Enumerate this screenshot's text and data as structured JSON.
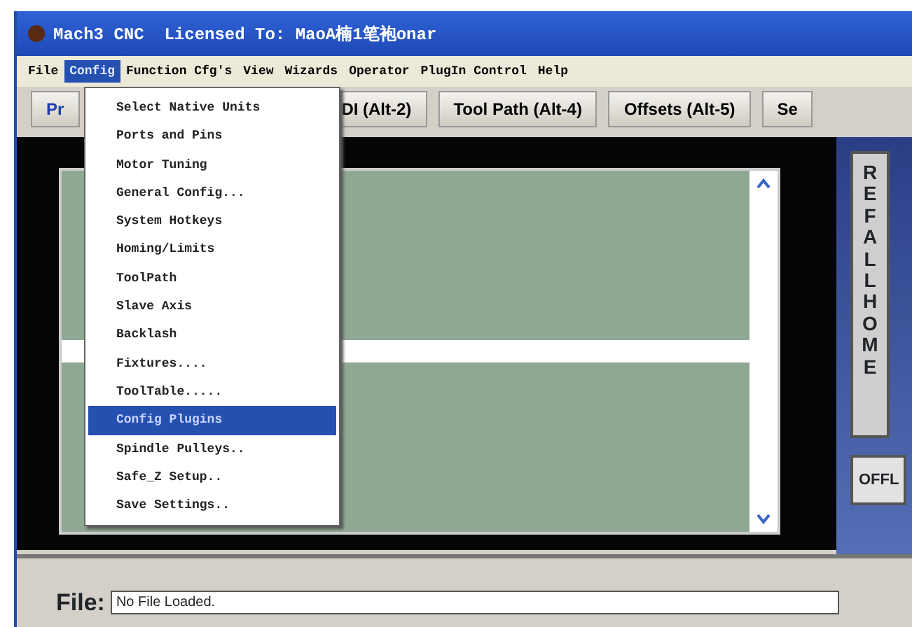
{
  "window": {
    "title": "Mach3 CNC  Licensed To: MaoA楠1笔袍onar"
  },
  "menu_bar": [
    {
      "label": "File",
      "selected": false
    },
    {
      "label": "Config",
      "selected": true
    },
    {
      "label": "Function Cfg's",
      "selected": false
    },
    {
      "label": "View",
      "selected": false
    },
    {
      "label": "Wizards",
      "selected": false
    },
    {
      "label": "Operator",
      "selected": false
    },
    {
      "label": "PlugIn Control",
      "selected": false
    },
    {
      "label": "Help",
      "selected": false
    }
  ],
  "config_menu": [
    {
      "label": "Select Native Units",
      "selected": false
    },
    {
      "label": "Ports and Pins",
      "selected": false
    },
    {
      "label": "Motor Tuning",
      "selected": false
    },
    {
      "label": "General Config...",
      "selected": false
    },
    {
      "label": "System Hotkeys",
      "selected": false
    },
    {
      "label": "Homing/Limits",
      "selected": false
    },
    {
      "label": "ToolPath",
      "selected": false
    },
    {
      "label": "Slave Axis",
      "selected": false
    },
    {
      "label": "Backlash",
      "selected": false
    },
    {
      "label": "Fixtures....",
      "selected": false
    },
    {
      "label": "ToolTable.....",
      "selected": false
    },
    {
      "label": "Config Plugins",
      "selected": true
    },
    {
      "label": "Spindle Pulleys..",
      "selected": false
    },
    {
      "label": "Safe_Z Setup..",
      "selected": false
    },
    {
      "label": "Save Settings..",
      "selected": false
    }
  ],
  "tabs": [
    {
      "label": "Pr"
    },
    {
      "label": "DI (Alt-2)"
    },
    {
      "label": "Tool Path (Alt-4)"
    },
    {
      "label": "Offsets (Alt-5)"
    },
    {
      "label": "Se"
    }
  ],
  "side_buttons": [
    {
      "label": "REF ALL HOME",
      "kind": "vertical"
    },
    {
      "label": "OFFL",
      "kind": "horizontal"
    }
  ],
  "file_row": {
    "label": "File:",
    "value": "No File Loaded."
  }
}
